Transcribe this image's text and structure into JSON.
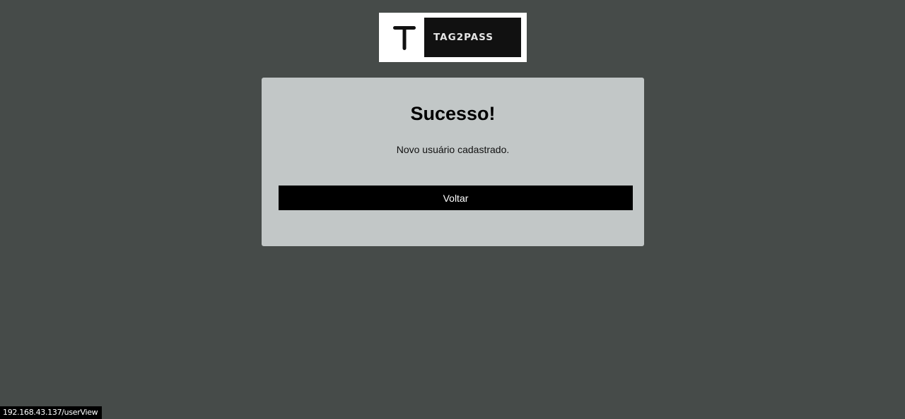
{
  "logo": {
    "mark": "T",
    "text": "TAG2PASS"
  },
  "card": {
    "title": "Sucesso!",
    "message": "Novo usuário cadastrado.",
    "button_label": "Voltar"
  },
  "status_bar": {
    "url": "192.168.43.137/userView"
  },
  "colors": {
    "background": "#464b49",
    "card": "#c2c7c7",
    "button": "#000000",
    "button_text": "#ffffff"
  }
}
